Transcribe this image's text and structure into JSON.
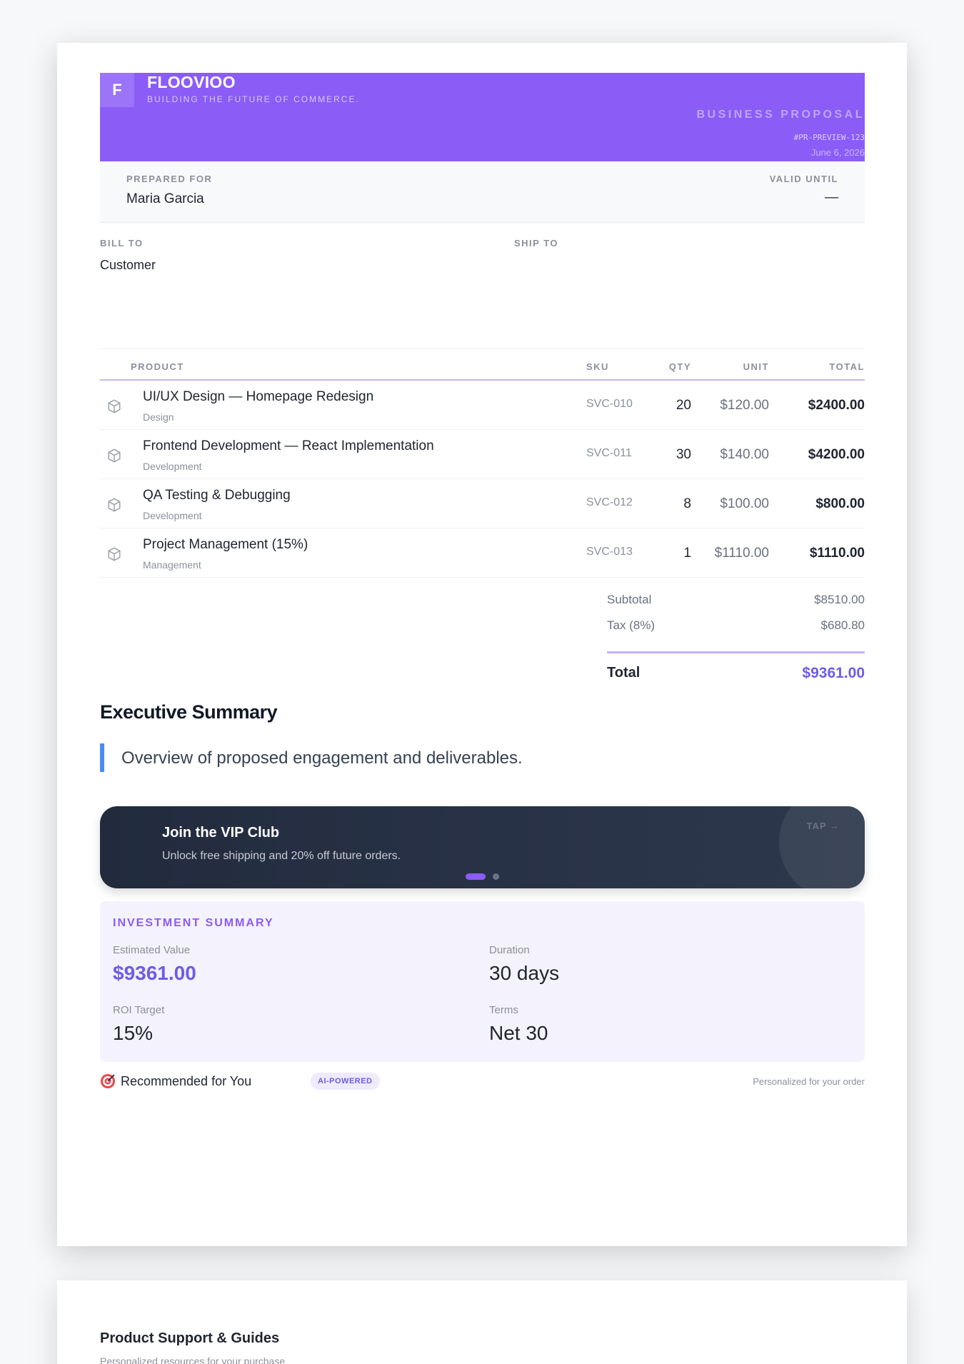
{
  "brand": {
    "logo_letter": "F",
    "name": "FLOOVIOO",
    "tagline": "BUILDING THE FUTURE OF COMMERCE."
  },
  "document": {
    "type": "BUSINESS PROPOSAL",
    "number": "#PR-PREVIEW-123",
    "date": "June 6, 2026"
  },
  "prepared": {
    "for_label": "PREPARED FOR",
    "for_value": "Maria Garcia",
    "valid_label": "VALID UNTIL",
    "valid_value": "—"
  },
  "addresses": {
    "bill_label": "BILL TO",
    "bill_value": "Customer",
    "ship_label": "SHIP TO"
  },
  "table": {
    "headers": {
      "product": "PRODUCT",
      "sku": "SKU",
      "qty": "QTY",
      "unit": "UNIT",
      "total": "TOTAL"
    },
    "rows": [
      {
        "name": "UI/UX Design — Homepage Redesign",
        "category": "Design",
        "sku": "SVC-010",
        "qty": "20",
        "unit": "$120.00",
        "total": "$2400.00"
      },
      {
        "name": "Frontend Development — React Implementation",
        "category": "Development",
        "sku": "SVC-011",
        "qty": "30",
        "unit": "$140.00",
        "total": "$4200.00"
      },
      {
        "name": "QA Testing & Debugging",
        "category": "Development",
        "sku": "SVC-012",
        "qty": "8",
        "unit": "$100.00",
        "total": "$800.00"
      },
      {
        "name": "Project Management (15%)",
        "category": "Management",
        "sku": "SVC-013",
        "qty": "1",
        "unit": "$1110.00",
        "total": "$1110.00"
      }
    ]
  },
  "totals": {
    "subtotal_label": "Subtotal",
    "subtotal_value": "$8510.00",
    "tax_label": "Tax (8%)",
    "tax_value": "$680.80",
    "total_label": "Total",
    "total_value": "$9361.00"
  },
  "summary": {
    "title": "Executive Summary",
    "quote": "Overview of proposed engagement and deliverables."
  },
  "vip": {
    "title": "Join the VIP Club",
    "subtitle": "Unlock free shipping and 20% off future orders.",
    "tap": "TAP →"
  },
  "investment": {
    "title": "INVESTMENT SUMMARY",
    "items": [
      {
        "label": "Estimated Value",
        "value": "$9361.00"
      },
      {
        "label": "Duration",
        "value": "30 days"
      },
      {
        "label": "ROI Target",
        "value": "15%"
      },
      {
        "label": "Terms",
        "value": "Net 30"
      }
    ]
  },
  "recommended": {
    "title": "Recommended for You",
    "badge": "AI-POWERED",
    "note": "Personalized for your order"
  },
  "page2": {
    "title": "Product Support & Guides",
    "subtitle": "Personalized resources for your purchase"
  },
  "colors": {
    "brand": "#8b5cf6",
    "accent_total": "#6d5ce7",
    "quote_bar": "#4a8cf7",
    "vip_bg": "#222b3e"
  },
  "icons": {
    "product_row": "cube-icon",
    "recommended": "target-icon"
  }
}
